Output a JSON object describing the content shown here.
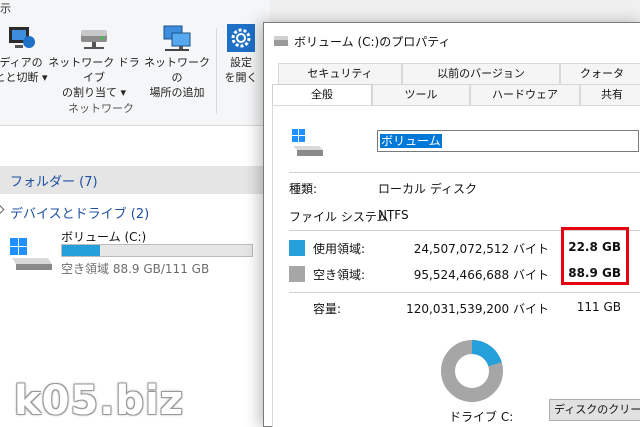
{
  "explorer": {
    "ribbon_tab": "示",
    "buttons": [
      {
        "label1": "ディアの",
        "label2": "とと切断 ▾"
      },
      {
        "label1": "ネットワーク ドライブ",
        "label2": "の割り当て ▾"
      },
      {
        "label1": "ネットワークの",
        "label2": "場所の追加"
      },
      {
        "label1": "設定",
        "label2": "を開く"
      }
    ],
    "group_label": "ネットワーク",
    "folders_header": "フォルダー (7)",
    "devices_header": "デバイスとドライブ (2)",
    "drive": {
      "name": "ボリューム (C:)",
      "free_text": "空き領域 88.9 GB/111 GB",
      "used_fraction": 0.2,
      "bar_color": "#26a0da"
    }
  },
  "dialog": {
    "title": "ボリューム (C:)のプロパティ",
    "tabs_back": [
      "セキュリティ",
      "以前のバージョン",
      "クォータ"
    ],
    "tabs_front": [
      "全般",
      "ツール",
      "ハードウェア",
      "共有"
    ],
    "volume_name": "ボリューム",
    "type_label": "種類:",
    "type_value": "ローカル ディスク",
    "fs_label": "ファイル システム:",
    "fs_value": "NTFS",
    "used_label": "使用領域:",
    "used_bytes": "24,507,072,512 バイト",
    "used_gb": "22.8 GB",
    "used_color": "#26a0da",
    "free_label": "空き領域:",
    "free_bytes": "95,524,466,688 バイト",
    "free_gb": "88.9 GB",
    "free_color": "#a6a6a6",
    "capacity_label": "容量:",
    "capacity_bytes": "120,031,539,200 バイト",
    "capacity_gb": "111 GB",
    "used_fraction": 0.204,
    "drive_caption": "ドライブ C:",
    "cleanup_button": "ディスクのクリーンアップ"
  },
  "watermark": "k05.biz"
}
